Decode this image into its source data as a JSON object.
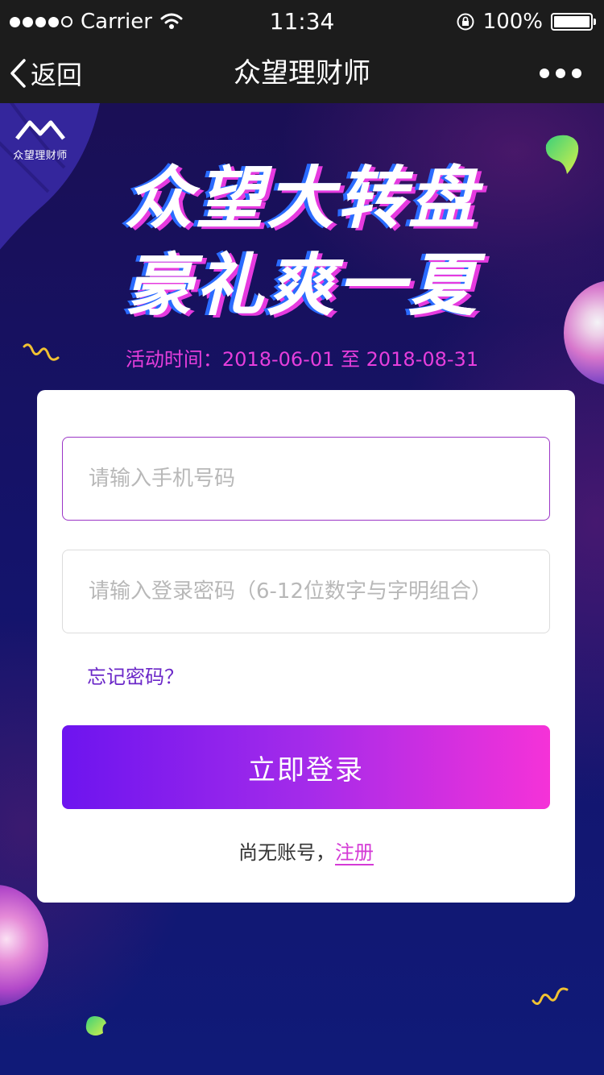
{
  "status_bar": {
    "carrier": "Carrier",
    "time": "11:34",
    "battery": "100%",
    "battery_level": 1.0
  },
  "nav": {
    "back_label": "返回",
    "title": "众望理财师"
  },
  "brand": {
    "logo_text": "众望理财师"
  },
  "hero": {
    "headline_line1": "众望大转盘",
    "headline_line2": "豪礼爽一夏",
    "event_time": "活动时间：2018-06-01 至 2018-08-31"
  },
  "form": {
    "phone_placeholder": "请输入手机号码",
    "password_placeholder": "请输入登录密码（6-12位数字与字明组合）",
    "forgot_label": "忘记密码？",
    "login_label": "立即登录",
    "no_account_text": "尚无账号，",
    "register_label": "注册"
  },
  "colors": {
    "accent_purple": "#6d14ef",
    "accent_pink": "#f532d8",
    "event_time": "#e63edc",
    "link": "#6b28c8"
  }
}
